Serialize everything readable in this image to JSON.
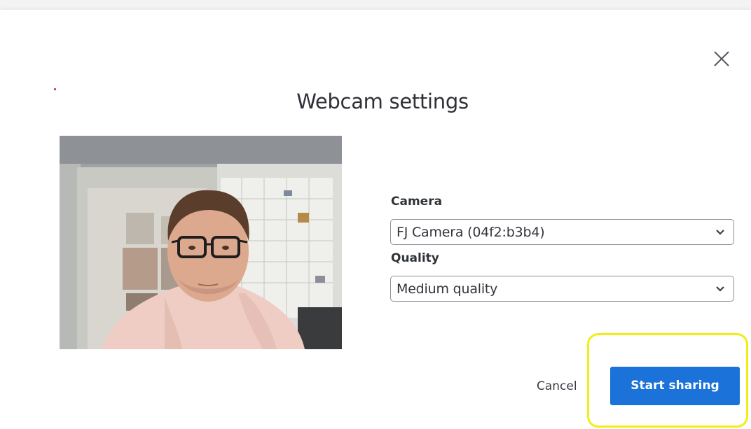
{
  "dialog": {
    "title": "Webcam settings",
    "close_icon": "close-icon"
  },
  "preview": {
    "alt": "webcam-preview"
  },
  "camera": {
    "label": "Camera",
    "selected": "FJ Camera (04f2:b3b4)",
    "icon": "chevron-down-icon"
  },
  "quality": {
    "label": "Quality",
    "selected": "Medium quality",
    "icon": "chevron-down-icon"
  },
  "actions": {
    "cancel_label": "Cancel",
    "start_label": "Start sharing"
  },
  "colors": {
    "accent": "#1b72d8",
    "highlight": "#f1ee16"
  }
}
